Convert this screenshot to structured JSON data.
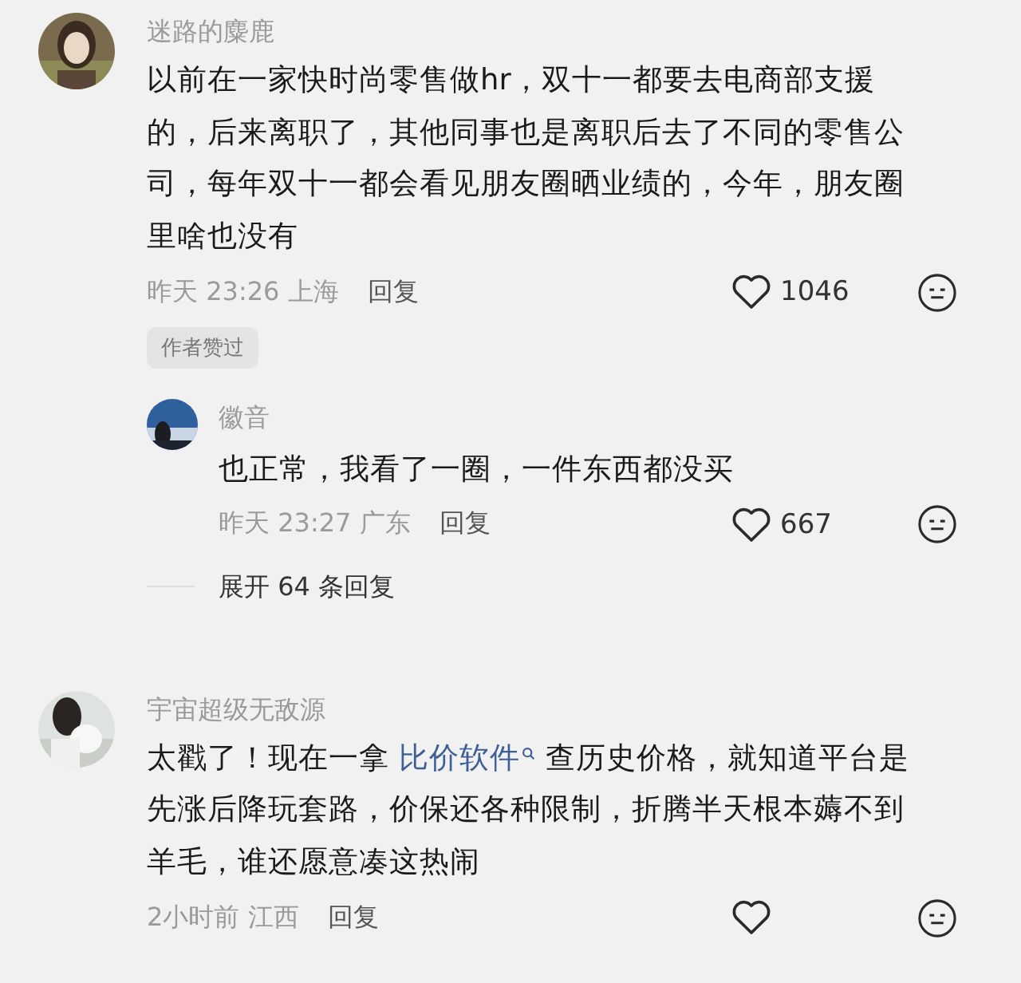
{
  "comments": [
    {
      "name": "迷路的麋鹿",
      "segments": [
        {
          "kind": "text",
          "text": "以前在一家快时尚零售做hr，双十一都要去电商部支援的，后来离职了，其他同事也是离职后去了不同的零售公司，每年双十一都会看见朋友圈晒业绩的，今年，朋友圈里啥也没有"
        }
      ],
      "time": "昨天 23:26 上海",
      "reply_label": "回复",
      "likes": "1046",
      "tag": "作者赞过",
      "replies": [
        {
          "name": "徽音",
          "segments": [
            {
              "kind": "text",
              "text": "也正常，我看了一圈，一件东西都没买"
            }
          ],
          "time": "昨天 23:27 广东",
          "reply_label": "回复",
          "likes": "667"
        }
      ],
      "expand": "展开 64 条回复"
    },
    {
      "name": "宇宙超级无敌源",
      "segments": [
        {
          "kind": "text",
          "text": "太戳了！现在一拿 "
        },
        {
          "kind": "link",
          "text": "比价软件"
        },
        {
          "kind": "text",
          "text": " 查历史价格，就知道平台是先涨后降玩套路，价保还各种限制，折腾半天根本薅不到羊毛，谁还愿意凑这热闹"
        }
      ],
      "time": "2小时前 江西",
      "reply_label": "回复"
    }
  ]
}
